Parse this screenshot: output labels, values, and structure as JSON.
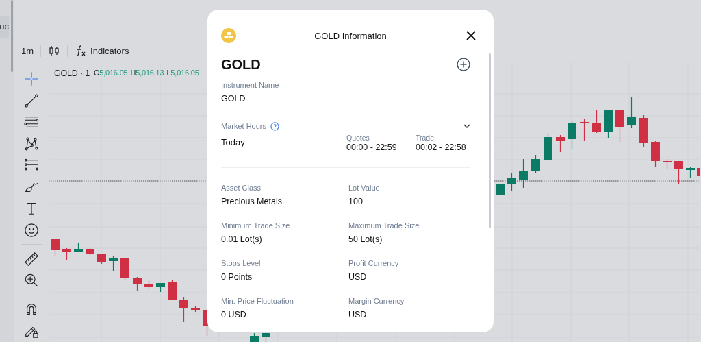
{
  "sidebar_tab": {
    "label": "nc"
  },
  "toolbar": {
    "interval": "1m",
    "indicators": "Indicators"
  },
  "legend": {
    "symbol": "GOLD · 1",
    "values": [
      {
        "label": "O",
        "value": "5,016.05"
      },
      {
        "label": "H",
        "value": "5,016.13"
      },
      {
        "label": "L",
        "value": "5,016.05"
      }
    ]
  },
  "drawing_tools": [
    {
      "kind": "crosshair",
      "selected": true
    },
    {
      "kind": "trend-line",
      "selected": false
    },
    {
      "kind": "parallel-lines",
      "selected": false
    },
    {
      "kind": "pattern",
      "selected": false
    },
    {
      "kind": "levels",
      "selected": false
    },
    {
      "kind": "brush",
      "selected": false
    },
    {
      "kind": "text",
      "selected": false
    },
    {
      "kind": "emoji",
      "selected": false
    },
    {
      "kind": "ruler",
      "selected": false
    },
    {
      "kind": "zoom",
      "selected": false
    },
    {
      "kind": "magnet",
      "selected": false
    },
    {
      "kind": "lock-pencil",
      "selected": false
    }
  ],
  "dialog": {
    "title": "GOLD Information",
    "symbol": "GOLD",
    "instrument_name": {
      "label": "Instrument Name",
      "value": "GOLD"
    },
    "market_hours": {
      "label": "Market Hours",
      "day": "Today",
      "sessions": [
        {
          "label": "Quotes",
          "value": "00:00 - 22:59"
        },
        {
          "label": "Trade",
          "value": "00:02 - 22:58"
        }
      ]
    },
    "details": [
      {
        "label": "Asset Class",
        "value": "Precious Metals"
      },
      {
        "label": "Lot Value",
        "value": "100"
      },
      {
        "label": "Minimum Trade Size",
        "value": "0.01 Lot(s)"
      },
      {
        "label": "Maximum Trade Size",
        "value": "50 Lot(s)"
      },
      {
        "label": "Stops Level",
        "value": "0 Points"
      },
      {
        "label": "Profit Currency",
        "value": "USD"
      },
      {
        "label": "Min. Price Fluctuation",
        "value": "0 USD"
      },
      {
        "label": "Margin Currency",
        "value": "USD"
      }
    ]
  }
}
